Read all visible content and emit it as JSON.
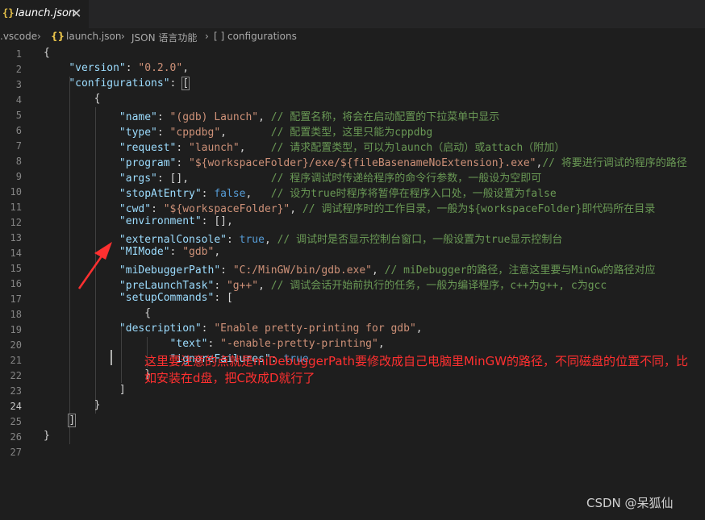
{
  "tab": {
    "icon": "{}",
    "label": "launch.json",
    "close": "✕"
  },
  "breadcrumb": {
    "items": [
      ".vscode",
      "launch.json",
      "JSON 语言功能",
      "[ ] configurations"
    ],
    "separator": "›",
    "file_icon": "{}"
  },
  "editor": {
    "line_numbers": [
      "1",
      "2",
      "3",
      "4",
      "5",
      "6",
      "7",
      "8",
      "9",
      "10",
      "11",
      "12",
      "13",
      "14",
      "15",
      "16",
      "17",
      "18",
      "19",
      "20",
      "21",
      "22",
      "23",
      "24",
      "25",
      "26",
      "27"
    ],
    "active_line": "24",
    "lines": [
      [
        [
          "t",
          "{"
        ]
      ],
      [
        [
          "t",
          "    "
        ],
        [
          "k",
          "\"version\""
        ],
        [
          "t",
          ": "
        ],
        [
          "s",
          "\"0.2.0\""
        ],
        [
          "t",
          ","
        ]
      ],
      [
        [
          "t",
          "    "
        ],
        [
          "k",
          "\"configurations\""
        ],
        [
          "t",
          ": "
        ],
        [
          "t",
          "["
        ]
      ],
      [
        [
          "t",
          "        {"
        ]
      ],
      [
        [
          "t",
          "            "
        ],
        [
          "k",
          "\"name\""
        ],
        [
          "t",
          ": "
        ],
        [
          "s",
          "\"(gdb) Launch\""
        ],
        [
          "t",
          ", "
        ],
        [
          "c",
          "// 配置名称，将会在启动配置的下拉菜单中显示"
        ]
      ],
      [
        [
          "t",
          "            "
        ],
        [
          "k",
          "\"type\""
        ],
        [
          "t",
          ": "
        ],
        [
          "s",
          "\"cppdbg\""
        ],
        [
          "t",
          ",       "
        ],
        [
          "c",
          "// 配置类型，这里只能为cppdbg"
        ]
      ],
      [
        [
          "t",
          "            "
        ],
        [
          "k",
          "\"request\""
        ],
        [
          "t",
          ": "
        ],
        [
          "s",
          "\"launch\""
        ],
        [
          "t",
          ",    "
        ],
        [
          "c",
          "// 请求配置类型，可以为launch（启动）或attach（附加）"
        ]
      ],
      [
        [
          "t",
          "            "
        ],
        [
          "k",
          "\"program\""
        ],
        [
          "t",
          ": "
        ],
        [
          "s",
          "\"${workspaceFolder}/exe/${fileBasenameNoExtension}.exe\""
        ],
        [
          "t",
          ","
        ],
        [
          "c",
          "// 将要进行调试的程序的路径"
        ]
      ],
      [
        [
          "t",
          "            "
        ],
        [
          "k",
          "\"args\""
        ],
        [
          "t",
          ": [],             "
        ],
        [
          "c",
          "// 程序调试时传递给程序的命令行参数，一般设为空即可"
        ]
      ],
      [
        [
          "t",
          "            "
        ],
        [
          "k",
          "\"stopAtEntry\""
        ],
        [
          "t",
          ": "
        ],
        [
          "b",
          "false"
        ],
        [
          "t",
          ",   "
        ],
        [
          "c",
          "// 设为true时程序将暂停在程序入口处，一般设置为false"
        ]
      ],
      [
        [
          "t",
          "            "
        ],
        [
          "k",
          "\"cwd\""
        ],
        [
          "t",
          ": "
        ],
        [
          "s",
          "\"${workspaceFolder}\""
        ],
        [
          "t",
          ", "
        ],
        [
          "c",
          "// 调试程序时的工作目录，一般为${workspaceFolder}即代码所在目录"
        ]
      ],
      [
        [
          "t",
          "            "
        ],
        [
          "k",
          "\"environment\""
        ],
        [
          "t",
          ": [],"
        ]
      ],
      [
        [
          "t",
          "            "
        ],
        [
          "k",
          "\"externalConsole\""
        ],
        [
          "t",
          ": "
        ],
        [
          "b",
          "true"
        ],
        [
          "t",
          ", "
        ],
        [
          "c",
          "// 调试时是否显示控制台窗口，一般设置为true显示控制台"
        ]
      ],
      [
        [
          "t",
          "            "
        ],
        [
          "k",
          "\"MIMode\""
        ],
        [
          "t",
          ": "
        ],
        [
          "s",
          "\"gdb\""
        ],
        [
          "t",
          ","
        ]
      ],
      [
        [
          "t",
          "            "
        ],
        [
          "k",
          "\"miDebuggerPath\""
        ],
        [
          "t",
          ": "
        ],
        [
          "s",
          "\"C:/MinGW/bin/gdb.exe\""
        ],
        [
          "t",
          ", "
        ],
        [
          "c",
          "// miDebugger的路径，注意这里要与MinGw的路径对应"
        ]
      ],
      [
        [
          "t",
          "            "
        ],
        [
          "k",
          "\"preLaunchTask\""
        ],
        [
          "t",
          ": "
        ],
        [
          "s",
          "\"g++\""
        ],
        [
          "t",
          ", "
        ],
        [
          "c",
          "// 调试会话开始前执行的任务，一般为编译程序，c++为g++, c为gcc"
        ]
      ],
      [
        [
          "t",
          "            "
        ],
        [
          "k",
          "\"setupCommands\""
        ],
        [
          "t",
          ": ["
        ]
      ],
      [
        [
          "t",
          "                {"
        ]
      ],
      [
        [
          "t",
          "            "
        ],
        [
          "k",
          "\"description\""
        ],
        [
          "t",
          ": "
        ],
        [
          "s",
          "\"Enable pretty-printing for gdb\""
        ],
        [
          "t",
          ","
        ]
      ],
      [
        [
          "t",
          "                    "
        ],
        [
          "k",
          "\"text\""
        ],
        [
          "t",
          ": "
        ],
        [
          "s",
          "\"-enable-pretty-printing\""
        ],
        [
          "t",
          ","
        ]
      ],
      [
        [
          "t",
          "                    "
        ],
        [
          "k",
          "\"ignoreFailures\""
        ],
        [
          "t",
          ": "
        ],
        [
          "b",
          "true"
        ]
      ],
      [
        [
          "t",
          "                }"
        ]
      ],
      [
        [
          "t",
          "            ]"
        ]
      ],
      [
        [
          "t",
          "        }"
        ]
      ],
      [
        [
          "t",
          "    "
        ],
        [
          "t",
          "]"
        ]
      ],
      [
        [
          "t",
          "}"
        ]
      ],
      [
        [
          "t",
          ""
        ]
      ]
    ]
  },
  "annotation": {
    "text": "这里要注意的点就是miDebuggerPath要修改成自己电脑里MinGW的路径，不同磁盘的位置不同，比如安装在d盘，把C改成D就行了",
    "color": "#ff3030"
  },
  "watermark": "CSDN @呆狐仙",
  "colors": {
    "key": "#9cdcfe",
    "string": "#ce9178",
    "comment": "#6a9955",
    "boolean": "#569cd6",
    "background": "#1e1e1e"
  }
}
